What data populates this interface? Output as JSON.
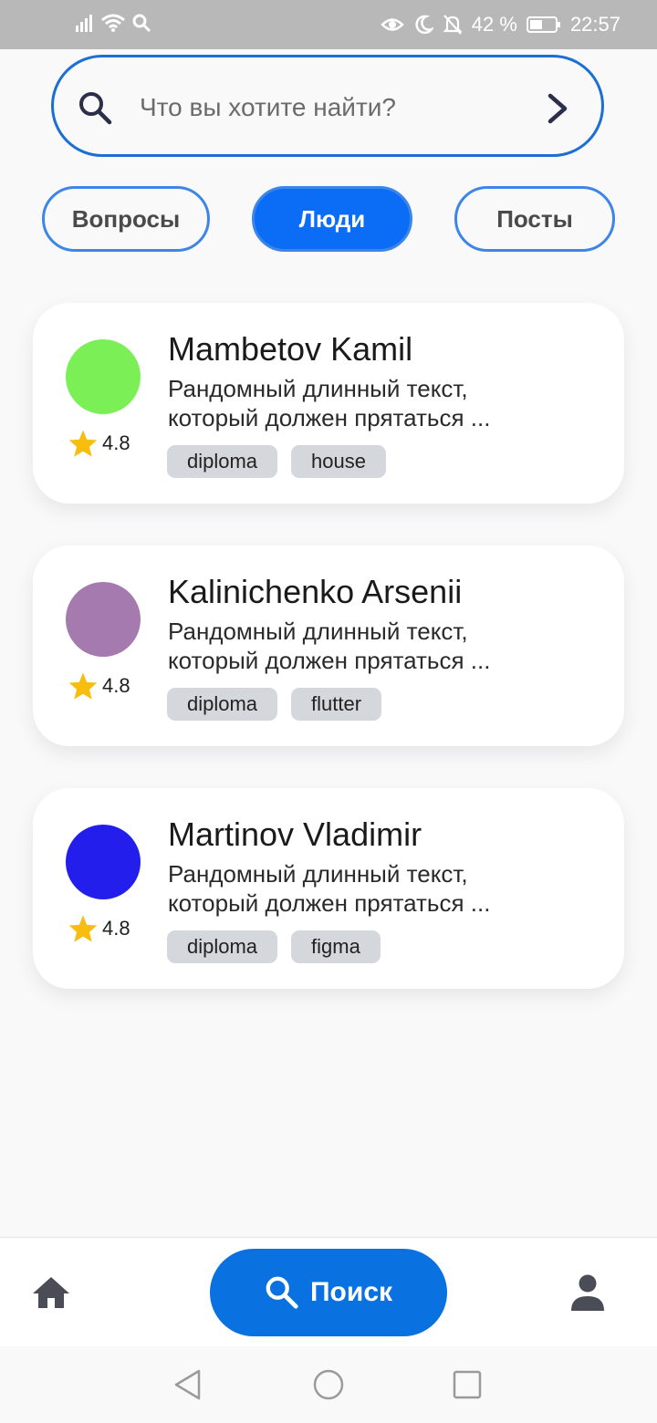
{
  "status_bar": {
    "battery": "42 %",
    "time": "22:57"
  },
  "search": {
    "placeholder": "Что вы хотите найти?"
  },
  "filters": [
    {
      "label": "Вопросы",
      "active": false
    },
    {
      "label": "Люди",
      "active": true
    },
    {
      "label": "Посты",
      "active": false
    }
  ],
  "people": [
    {
      "name": "Mambetov Kamil",
      "description": "Рандомный длинный текст, который должен прятаться ...",
      "rating": "4.8",
      "avatar_color": "#7bf056",
      "tags": [
        "diploma",
        "house"
      ]
    },
    {
      "name": "Kalinichenko Arsenii",
      "description": "Рандомный длинный текст, который должен прятаться ...",
      "rating": "4.8",
      "avatar_color": "#a57aae",
      "tags": [
        "diploma",
        "flutter"
      ]
    },
    {
      "name": "Martinov Vladimir",
      "description": "Рандомный длинный текст, который должен прятаться ...",
      "rating": "4.8",
      "avatar_color": "#241eec",
      "tags": [
        "diploma",
        "figma"
      ]
    }
  ],
  "bottom_nav": {
    "search_label": "Поиск",
    "icons": [
      "home-icon",
      "search-icon",
      "person-icon"
    ]
  },
  "colors": {
    "accent": "#0a72e0",
    "tab_active": "#0b6cf5",
    "star": "#f7bd0f",
    "tag_bg": "#d4d7dc"
  }
}
